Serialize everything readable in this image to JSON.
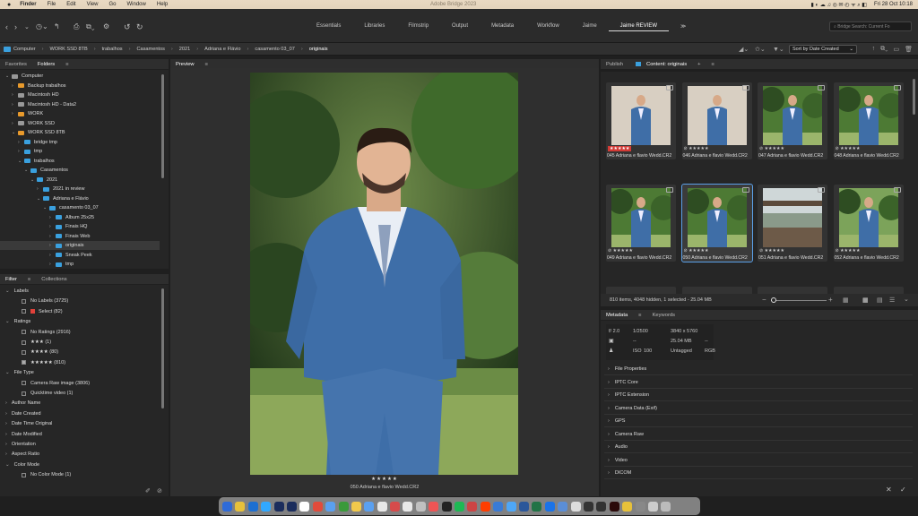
{
  "menubar": {
    "apple": "",
    "app": "Finder",
    "items": [
      "File",
      "Edit",
      "View",
      "Go",
      "Window",
      "Help"
    ],
    "title": "Adobe Bridge 2023",
    "clock": "Fri 28 Oct  10:18"
  },
  "toolbar": {
    "workspaces": [
      "Essentials",
      "Libraries",
      "Filmstrip",
      "Output",
      "Metadata",
      "Workflow",
      "Jaime",
      "Jaime REVIEW"
    ],
    "active": "Jaime REVIEW",
    "search_placeholder": "Bridge Search: Current Fo"
  },
  "path": {
    "crumbs": [
      "Computer",
      "WORK SSD 8TB",
      "trabalhos",
      "Casamentos",
      "2021",
      "Adriana e Flávio",
      "casamento 03_07",
      "originais"
    ],
    "sort": "Sort by Date Created"
  },
  "left": {
    "tabs": [
      "Favorites",
      "Folders"
    ],
    "tree": [
      {
        "label": "Computer",
        "lvl": 0,
        "type": "dk",
        "open": true
      },
      {
        "label": "Backup trabalhos",
        "lvl": 1,
        "type": "fdo"
      },
      {
        "label": "Macintosh HD",
        "lvl": 1,
        "type": "dk"
      },
      {
        "label": "Macintosh HD - Data2",
        "lvl": 1,
        "type": "dk"
      },
      {
        "label": "WORK",
        "lvl": 1,
        "type": "fdo"
      },
      {
        "label": "WORK SSD",
        "lvl": 1,
        "type": "dk"
      },
      {
        "label": "WORK SSD 8TB",
        "lvl": 1,
        "type": "fdo",
        "open": true
      },
      {
        "label": "bridge tmp",
        "lvl": 2,
        "type": "fd"
      },
      {
        "label": "tmp",
        "lvl": 2,
        "type": "fd"
      },
      {
        "label": "trabalhos",
        "lvl": 2,
        "type": "fd",
        "open": true
      },
      {
        "label": "Casamentos",
        "lvl": 3,
        "type": "fd",
        "open": true
      },
      {
        "label": "2021",
        "lvl": 4,
        "type": "fd",
        "open": true
      },
      {
        "label": "2021 in review",
        "lvl": 5,
        "type": "fd"
      },
      {
        "label": "Adriana e Flávio",
        "lvl": 5,
        "type": "fd",
        "open": true
      },
      {
        "label": "casamento 03_07",
        "lvl": 6,
        "type": "fd",
        "open": true
      },
      {
        "label": "Album 25x25",
        "lvl": 7,
        "type": "fd"
      },
      {
        "label": "Finais HQ",
        "lvl": 7,
        "type": "fd"
      },
      {
        "label": "Finais Web",
        "lvl": 7,
        "type": "fd"
      },
      {
        "label": "originais",
        "lvl": 7,
        "type": "fd",
        "sel": true
      },
      {
        "label": "Sneak Peek",
        "lvl": 7,
        "type": "fd"
      },
      {
        "label": "tmp",
        "lvl": 7,
        "type": "fd"
      }
    ]
  },
  "filter": {
    "tabs": [
      "Filter",
      "Collections"
    ],
    "rows": [
      {
        "label": "Labels",
        "kind": "head",
        "open": true
      },
      {
        "label": "No Labels  (3725)",
        "kind": "cb"
      },
      {
        "label": "Select  (82)",
        "kind": "cbred"
      },
      {
        "label": "Ratings",
        "kind": "head",
        "open": true
      },
      {
        "label": "No Ratings  (2916)",
        "kind": "cb"
      },
      {
        "label": "★★★  (1)",
        "kind": "cb"
      },
      {
        "label": "★★★★  (80)",
        "kind": "cb"
      },
      {
        "label": "★★★★★  (810)",
        "kind": "cbon"
      },
      {
        "label": "File Type",
        "kind": "head",
        "open": true
      },
      {
        "label": "Camera Raw image  (3806)",
        "kind": "cb"
      },
      {
        "label": "Quicktime video  (1)",
        "kind": "cb"
      },
      {
        "label": "Author Name",
        "kind": "head"
      },
      {
        "label": "Date Created",
        "kind": "head"
      },
      {
        "label": "Date Time Original",
        "kind": "head"
      },
      {
        "label": "Date Modified",
        "kind": "head"
      },
      {
        "label": "Orientation",
        "kind": "head"
      },
      {
        "label": "Aspect Ratio",
        "kind": "head"
      },
      {
        "label": "Color Mode",
        "kind": "head",
        "open": true
      },
      {
        "label": "No Color Mode  (1)",
        "kind": "cb"
      }
    ]
  },
  "preview": {
    "tab": "Preview",
    "stars": "★★★★★",
    "caption": "050 Adriana e flavio Wedd.CR2"
  },
  "content": {
    "tabs": [
      "Publish",
      "Content: originais"
    ],
    "status": "810 items, 4048 hidden, 1 selected - 25.04 MB",
    "thumbs": [
      {
        "name": "045 Adriana e flavio Wedd.CR2",
        "stars": "★★★★★",
        "red": true,
        "bg": "studio"
      },
      {
        "name": "046 Adriana e flavio Wedd.CR2",
        "stars": "⊘ ★★★★★",
        "bg": "studio"
      },
      {
        "name": "047 Adriana e flavio Wedd.CR2",
        "stars": "⊘ ★★★★★",
        "bg": "green"
      },
      {
        "name": "048 Adriana e flavio Wedd.CR2",
        "stars": "⊘ ★★★★★",
        "bg": "green"
      },
      {
        "name": "049 Adriana e flavio Wedd.CR2",
        "stars": "⊘ ★★★★★",
        "bg": "green"
      },
      {
        "name": "050 Adriana e flavio Wedd.CR2",
        "stars": "⊘ ★★★★★",
        "bg": "green",
        "sel": true
      },
      {
        "name": "051 Adriana e flavio Wedd.CR2",
        "stars": "⊘ ★★★★★",
        "bg": "view"
      },
      {
        "name": "052 Adriana e flavio Wedd.CR2",
        "stars": "⊘ ★★★★★",
        "bg": "garden"
      }
    ]
  },
  "metadata": {
    "tabs": [
      "Metadata",
      "Keywords"
    ],
    "fstop": "f/ 2.0",
    "shutter": "1/2500",
    "iso_label": "ISO",
    "iso": "100",
    "dims": "3840 x 5760",
    "size": "25.04 MB",
    "tag": "Untagged",
    "color": "RGB",
    "dash1": "--",
    "dash2": "--",
    "dash3": "--",
    "sections": [
      "File Properties",
      "IPTC Core",
      "IPTC Extension",
      "Camera Data (Exif)",
      "GPS",
      "Camera Raw",
      "Audio",
      "Video",
      "DICOM"
    ]
  }
}
